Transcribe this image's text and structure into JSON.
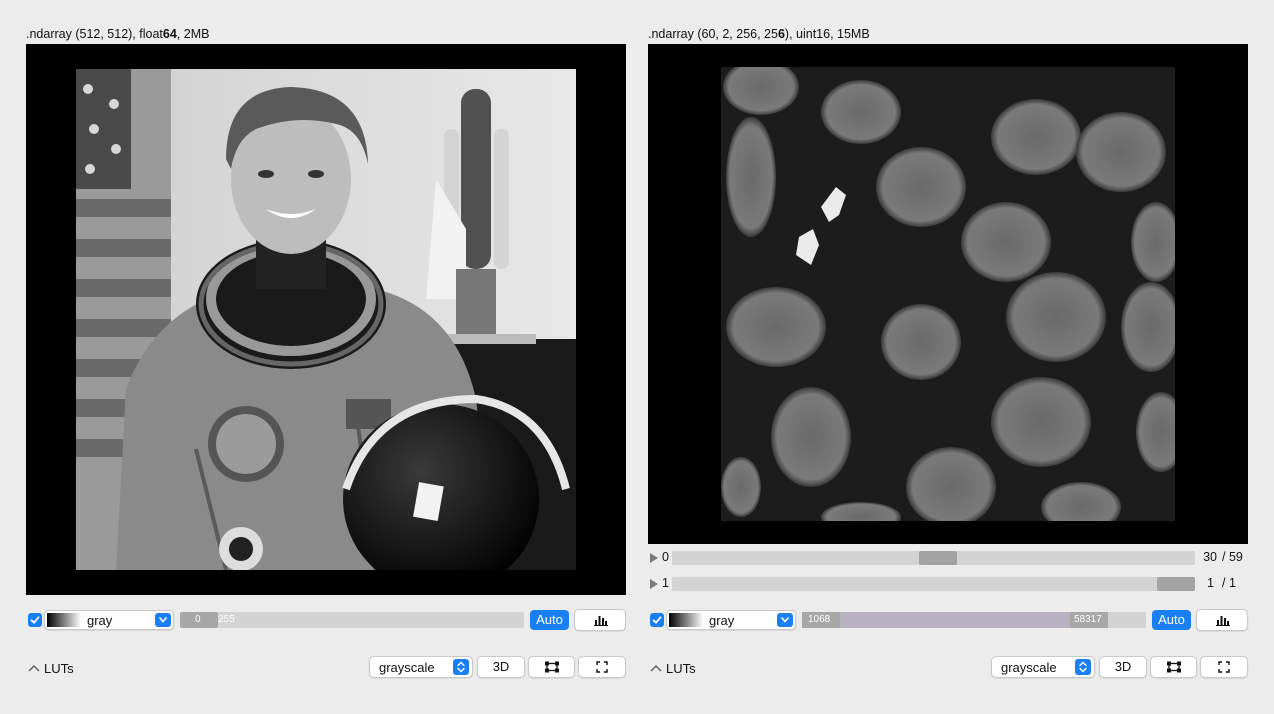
{
  "viewers": [
    {
      "title": {
        "prefix": ".ndarray (512, 512), float",
        "bits": "64",
        "suffix": ", 2MB"
      },
      "image": "astronaut portrait",
      "lut": {
        "visible": true,
        "cmap": "gray",
        "clim_low": "0",
        "clim_high": "255",
        "clim_range": [
          0.0,
          0.11
        ],
        "auto_label": "Auto"
      },
      "bottom": {
        "luts_label": "LUTs",
        "mode": "grayscale",
        "btn_3d": "3D"
      }
    },
    {
      "title": {
        "prefix": ".ndarray (60, 2, 256, 25",
        "bits": "6",
        "suffix": "), uint16, 15MB"
      },
      "image": "fluorescent cell nuclei",
      "dims": [
        {
          "min": "0",
          "current": "30",
          "max": "/ 59",
          "position": 0.5
        },
        {
          "min": "1",
          "current": "1",
          "max": "/ 1",
          "position": 1.0
        }
      ],
      "lut": {
        "visible": true,
        "cmap": "gray",
        "clim_low": "1068",
        "clim_high": "58317",
        "clim_range": [
          0.0,
          0.89
        ],
        "auto_label": "Auto"
      },
      "bottom": {
        "luts_label": "LUTs",
        "mode": "grayscale",
        "btn_3d": "3D"
      }
    }
  ],
  "colors": {
    "accent": "#1a7ff5",
    "canvas": "#000000",
    "background": "#ececec"
  }
}
